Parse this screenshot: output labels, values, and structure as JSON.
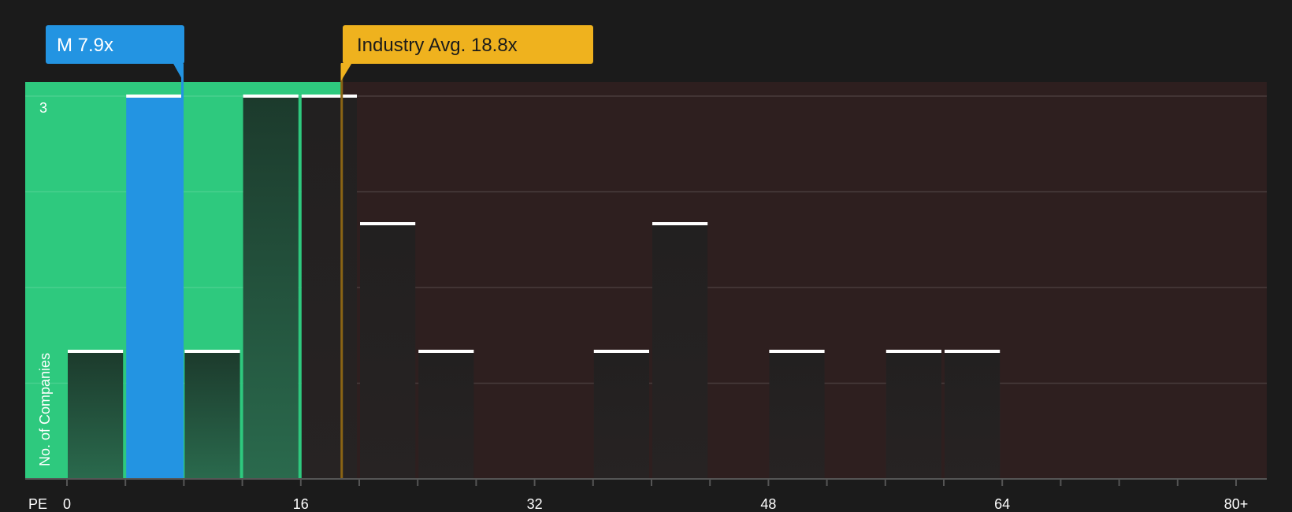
{
  "chart_data": {
    "type": "bar",
    "metric_label": "PE",
    "ylabel": "No. of Companies",
    "y_tick_label": "3",
    "x_tick_labels": [
      "0",
      "16",
      "32",
      "48",
      "64",
      "80+"
    ],
    "xlim": [
      0,
      80
    ],
    "ylim": [
      0,
      3
    ],
    "bin_width": 4,
    "bins": [
      {
        "start": 0,
        "count": 1
      },
      {
        "start": 4,
        "count": 3
      },
      {
        "start": 8,
        "count": 1
      },
      {
        "start": 12,
        "count": 3
      },
      {
        "start": 16,
        "count": 3
      },
      {
        "start": 20,
        "count": 2
      },
      {
        "start": 24,
        "count": 1
      },
      {
        "start": 36,
        "count": 1
      },
      {
        "start": 40,
        "count": 2
      },
      {
        "start": 48,
        "count": 1
      },
      {
        "start": 56,
        "count": 1
      },
      {
        "start": 60,
        "count": 1
      }
    ],
    "company": {
      "label": "M 7.9x",
      "value": 7.9,
      "color": "#2394e2"
    },
    "industry": {
      "label": "Industry Avg. 18.8x",
      "value": 18.8,
      "color": "#efb21e"
    },
    "colors": {
      "good_zone": "#2ec97e",
      "bad_zone": "#2e1f1f",
      "company_bar": "#2394e2",
      "background": "#1b1b1b"
    },
    "grid": true
  }
}
